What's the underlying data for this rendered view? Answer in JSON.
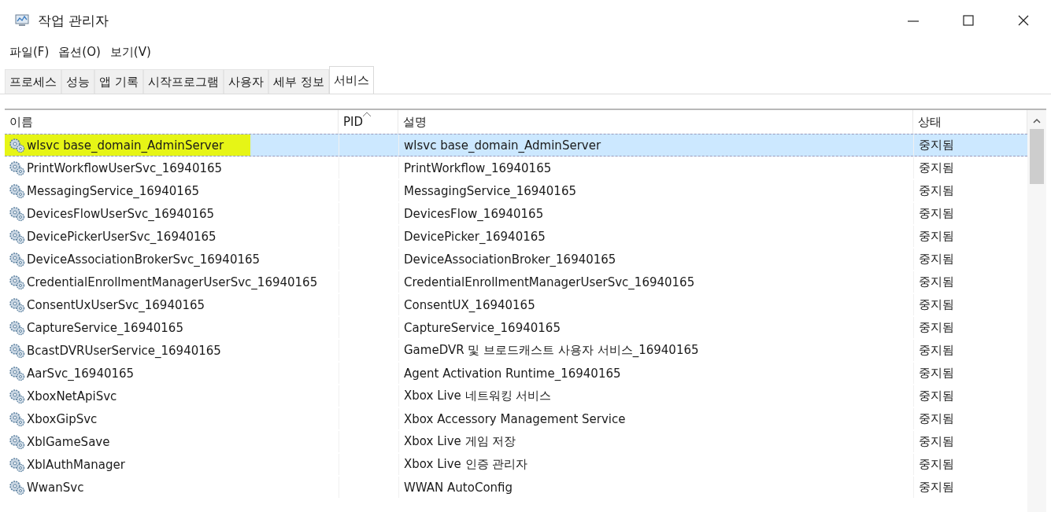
{
  "window": {
    "title": "작업 관리자"
  },
  "menu": [
    "파일(F)",
    "옵션(O)",
    "보기(V)"
  ],
  "tabs": [
    {
      "label": "프로세스",
      "selected": false
    },
    {
      "label": "성능",
      "selected": false
    },
    {
      "label": "앱 기록",
      "selected": false
    },
    {
      "label": "시작프로그램",
      "selected": false
    },
    {
      "label": "사용자",
      "selected": false
    },
    {
      "label": "세부 정보",
      "selected": false
    },
    {
      "label": "서비스",
      "selected": true
    }
  ],
  "table": {
    "columns": [
      {
        "label": "이름",
        "sorted": false
      },
      {
        "label": "PID",
        "sorted": true
      },
      {
        "label": "설명",
        "sorted": false
      },
      {
        "label": "상태",
        "sorted": false
      }
    ],
    "rows": [
      {
        "name": "wlsvc base_domain_AdminServer",
        "description": "wlsvc base_domain_AdminServer",
        "status": "중지됨",
        "selected": true,
        "highlighted": true
      },
      {
        "name": "PrintWorkflowUserSvc_16940165",
        "description": "PrintWorkflow_16940165",
        "status": "중지됨",
        "selected": false,
        "highlighted": false
      },
      {
        "name": "MessagingService_16940165",
        "description": "MessagingService_16940165",
        "status": "중지됨",
        "selected": false,
        "highlighted": false
      },
      {
        "name": "DevicesFlowUserSvc_16940165",
        "description": "DevicesFlow_16940165",
        "status": "중지됨",
        "selected": false,
        "highlighted": false
      },
      {
        "name": "DevicePickerUserSvc_16940165",
        "description": "DevicePicker_16940165",
        "status": "중지됨",
        "selected": false,
        "highlighted": false
      },
      {
        "name": "DeviceAssociationBrokerSvc_16940165",
        "description": "DeviceAssociationBroker_16940165",
        "status": "중지됨",
        "selected": false,
        "highlighted": false
      },
      {
        "name": "CredentialEnrollmentManagerUserSvc_16940165",
        "description": "CredentialEnrollmentManagerUserSvc_16940165",
        "status": "중지됨",
        "selected": false,
        "highlighted": false
      },
      {
        "name": "ConsentUxUserSvc_16940165",
        "description": "ConsentUX_16940165",
        "status": "중지됨",
        "selected": false,
        "highlighted": false
      },
      {
        "name": "CaptureService_16940165",
        "description": "CaptureService_16940165",
        "status": "중지됨",
        "selected": false,
        "highlighted": false
      },
      {
        "name": "BcastDVRUserService_16940165",
        "description": "GameDVR 및 브로드캐스트 사용자 서비스_16940165",
        "status": "중지됨",
        "selected": false,
        "highlighted": false
      },
      {
        "name": "AarSvc_16940165",
        "description": "Agent Activation Runtime_16940165",
        "status": "중지됨",
        "selected": false,
        "highlighted": false
      },
      {
        "name": "XboxNetApiSvc",
        "description": "Xbox Live 네트워킹 서비스",
        "status": "중지됨",
        "selected": false,
        "highlighted": false
      },
      {
        "name": "XboxGipSvc",
        "description": "Xbox Accessory Management Service",
        "status": "중지됨",
        "selected": false,
        "highlighted": false
      },
      {
        "name": "XblGameSave",
        "description": "Xbox Live 게임 저장",
        "status": "중지됨",
        "selected": false,
        "highlighted": false
      },
      {
        "name": "XblAuthManager",
        "description": "Xbox Live 인증 관리자",
        "status": "중지됨",
        "selected": false,
        "highlighted": false
      },
      {
        "name": "WwanSvc",
        "description": "WWAN AutoConfig",
        "status": "중지됨",
        "selected": false,
        "highlighted": false
      }
    ]
  }
}
